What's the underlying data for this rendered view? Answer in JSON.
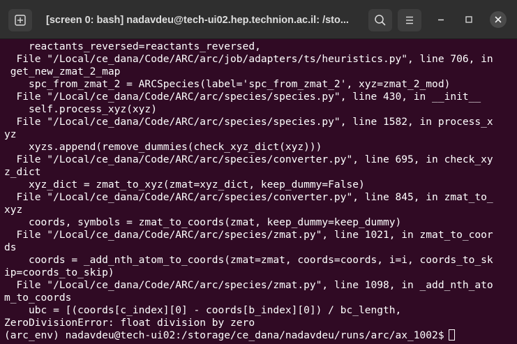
{
  "window": {
    "title": "[screen 0: bash] nadavdeu@tech-ui02.hep.technion.ac.il: /sto...",
    "buttons": {
      "new_tab_icon": "new-tab-icon",
      "search_icon": "search-icon",
      "menu_icon": "hamburger-menu-icon",
      "minimize_icon": "minimize-icon",
      "maximize_icon": "maximize-icon",
      "close_icon": "close-icon"
    }
  },
  "terminal": {
    "lines": [
      "    reactants_reversed=reactants_reversed,",
      "  File \"/Local/ce_dana/Code/ARC/arc/job/adapters/ts/heuristics.py\", line 706, in",
      " get_new_zmat_2_map",
      "    spc_from_zmat_2 = ARCSpecies(label='spc_from_zmat_2', xyz=zmat_2_mod)",
      "  File \"/Local/ce_dana/Code/ARC/arc/species/species.py\", line 430, in __init__",
      "    self.process_xyz(xyz)",
      "  File \"/Local/ce_dana/Code/ARC/arc/species/species.py\", line 1582, in process_x",
      "yz",
      "    xyzs.append(remove_dummies(check_xyz_dict(xyz)))",
      "  File \"/Local/ce_dana/Code/ARC/arc/species/converter.py\", line 695, in check_xy",
      "z_dict",
      "    xyz_dict = zmat_to_xyz(zmat=xyz_dict, keep_dummy=False)",
      "  File \"/Local/ce_dana/Code/ARC/arc/species/converter.py\", line 845, in zmat_to_",
      "xyz",
      "    coords, symbols = zmat_to_coords(zmat, keep_dummy=keep_dummy)",
      "  File \"/Local/ce_dana/Code/ARC/arc/species/zmat.py\", line 1021, in zmat_to_coor",
      "ds",
      "    coords = _add_nth_atom_to_coords(zmat=zmat, coords=coords, i=i, coords_to_sk",
      "ip=coords_to_skip)",
      "  File \"/Local/ce_dana/Code/ARC/arc/species/zmat.py\", line 1098, in _add_nth_ato",
      "m_to_coords",
      "    ubc = [(coords[c_index][0] - coords[b_index][0]) / bc_length,",
      "ZeroDivisionError: float division by zero"
    ],
    "prompt": "(arc_env) nadavdeu@tech-ui02:/storage/ce_dana/nadavdeu/runs/arc/ax_1002$"
  }
}
